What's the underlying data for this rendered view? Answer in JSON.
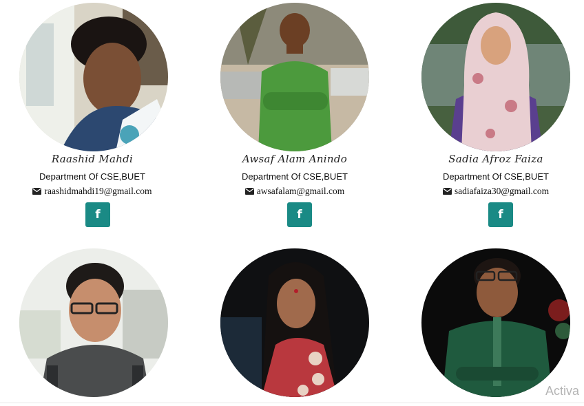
{
  "colors": {
    "facebook_button": "#1a8a85"
  },
  "members": [
    {
      "name": "Raashid Mahdi",
      "dept": "Department Of CSE,BUET",
      "email": "raashidmahdi19@gmail.com",
      "social_icon": "facebook-icon",
      "social_glyph": "f"
    },
    {
      "name": "Awsaf Alam Anindo",
      "dept": "Department Of CSE,BUET",
      "email": "awsafalam@gmail.com",
      "social_icon": "facebook-icon",
      "social_glyph": "f"
    },
    {
      "name": "Sadia Afroz Faiza",
      "dept": "Department Of CSE,BUET",
      "email": "sadiafaiza30@gmail.com",
      "social_icon": "facebook-icon",
      "social_glyph": "f"
    },
    {
      "name": "",
      "dept": "",
      "email": ""
    },
    {
      "name": "",
      "dept": "",
      "email": ""
    },
    {
      "name": "",
      "dept": "",
      "email": ""
    }
  ],
  "watermark": {
    "text": "Activa"
  }
}
